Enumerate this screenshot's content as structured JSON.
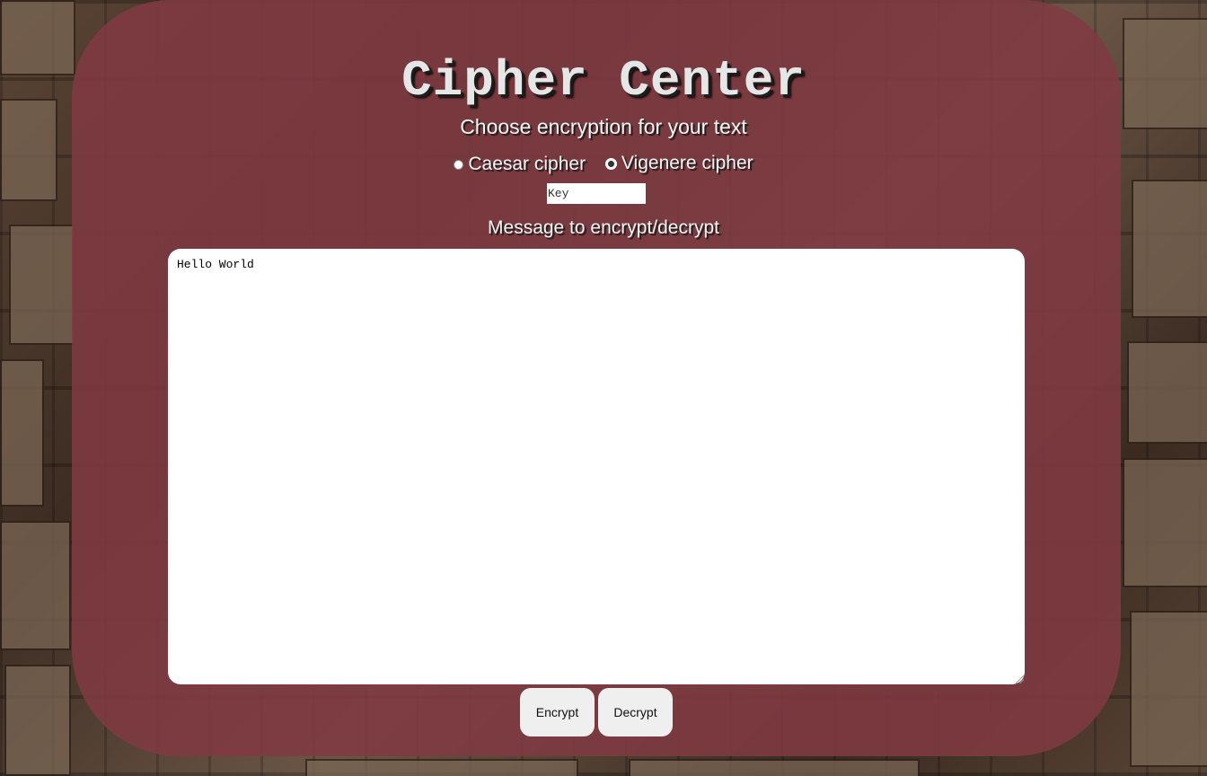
{
  "header": {
    "title": "Cipher Center",
    "subtitle": "Choose encryption for your text"
  },
  "cipher_options": [
    {
      "label": "Caesar cipher",
      "selected": false
    },
    {
      "label": "Vigenere cipher",
      "selected": true
    }
  ],
  "key_field": {
    "placeholder": "Key",
    "value": ""
  },
  "message": {
    "label": "Message to encrypt/decrypt",
    "value": "Hello World"
  },
  "actions": {
    "encrypt_label": "Encrypt",
    "decrypt_label": "Decrypt"
  },
  "colors": {
    "panel": "#803a42",
    "title_text": "#e6e6e6",
    "button_bg": "#efefef"
  }
}
